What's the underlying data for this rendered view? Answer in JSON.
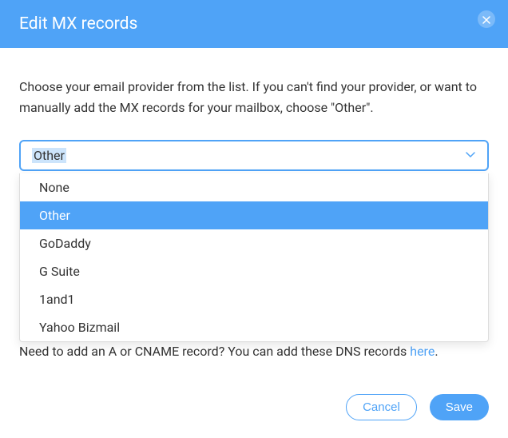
{
  "header": {
    "title": "Edit MX records"
  },
  "description": "Choose your email provider from the list. If you can't find your provider, or want to manually add the MX records for your mailbox, choose \"Other\".",
  "select": {
    "value": "Other",
    "options": [
      {
        "label": "None",
        "selected": false
      },
      {
        "label": "Other",
        "selected": true
      },
      {
        "label": "GoDaddy",
        "selected": false
      },
      {
        "label": "G Suite",
        "selected": false
      },
      {
        "label": "1and1",
        "selected": false
      },
      {
        "label": "Yahoo Bizmail",
        "selected": false
      }
    ]
  },
  "footer": {
    "prefix": "Need to add an A or CNAME record? You can add these DNS records ",
    "link": "here",
    "suffix": "."
  },
  "buttons": {
    "cancel": "Cancel",
    "save": "Save"
  }
}
